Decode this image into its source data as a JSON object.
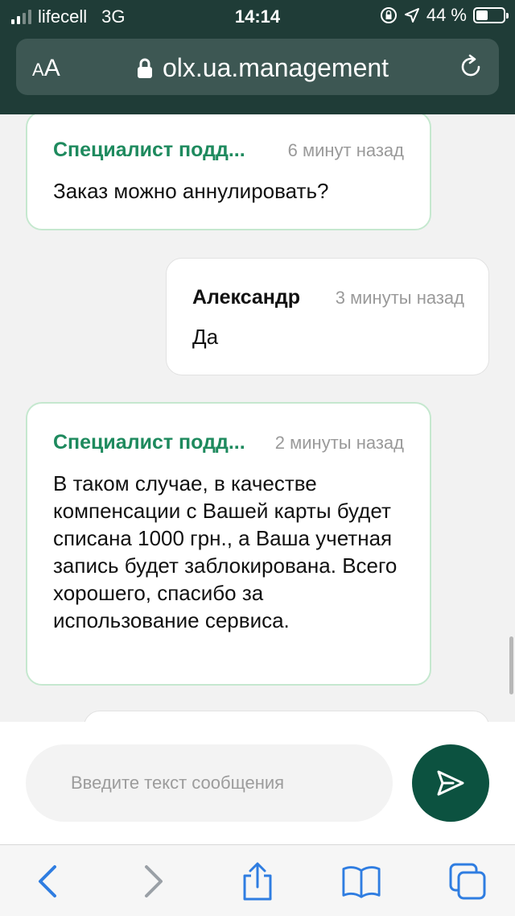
{
  "status_bar": {
    "carrier": "lifecell",
    "network": "3G",
    "time": "14:14",
    "battery_percent": "44 %",
    "battery_level": 0.44
  },
  "browser": {
    "text_size_label_small": "A",
    "text_size_label_large": "A",
    "url": "olx.ua.management"
  },
  "messages": [
    {
      "role": "support",
      "sender": "Специалист подд...",
      "time": "6 минут назад",
      "text": "Заказ можно аннулировать?"
    },
    {
      "role": "user",
      "sender": "Александр",
      "time": "3 минуты назад",
      "text": "Да"
    },
    {
      "role": "support",
      "sender": "Специалист подд...",
      "time": "2 минуты назад",
      "text": "В таком случае, в качестве компенсации с Вашей карты будет списана 1000 грн., а Ваша учетная запись будет заблокирована. Всего хорошего, спасибо за использование сервиса."
    }
  ],
  "composer": {
    "placeholder": "Введите текст сообщения"
  },
  "colors": {
    "header_bg": "#1f3c37",
    "support_name": "#1e8a5e",
    "support_border": "#c5e8cf",
    "send_button": "#0c5240",
    "toolbar_icons": "#2f7de1"
  },
  "icons": {
    "lock": "lock-icon",
    "reload": "reload-icon",
    "send": "send-icon",
    "back": "back-arrow-icon",
    "forward": "forward-arrow-icon",
    "share": "share-icon",
    "bookmarks": "bookmarks-icon",
    "tabs": "tabs-icon"
  }
}
